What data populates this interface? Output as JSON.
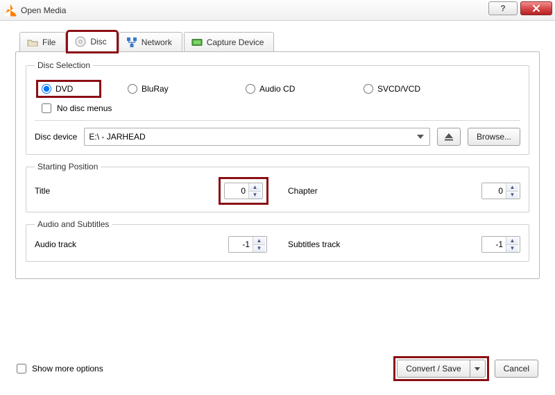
{
  "window": {
    "title": "Open Media"
  },
  "tabs": {
    "file": "File",
    "disc": "Disc",
    "network": "Network",
    "capture": "Capture Device"
  },
  "disc_selection": {
    "legend": "Disc Selection",
    "options": {
      "dvd": "DVD",
      "bluray": "BluRay",
      "audio_cd": "Audio CD",
      "svcd": "SVCD/VCD"
    },
    "no_menus_label": "No disc menus",
    "device_label": "Disc device",
    "device_value": "E:\\ - JARHEAD",
    "browse_label": "Browse..."
  },
  "starting_position": {
    "legend": "Starting Position",
    "title_label": "Title",
    "title_value": "0",
    "chapter_label": "Chapter",
    "chapter_value": "0"
  },
  "audio_subtitles": {
    "legend": "Audio and Subtitles",
    "audio_label": "Audio track",
    "audio_value": "-1",
    "sub_label": "Subtitles track",
    "sub_value": "-1"
  },
  "footer": {
    "show_more_label": "Show more options",
    "convert_label": "Convert / Save",
    "cancel_label": "Cancel"
  }
}
